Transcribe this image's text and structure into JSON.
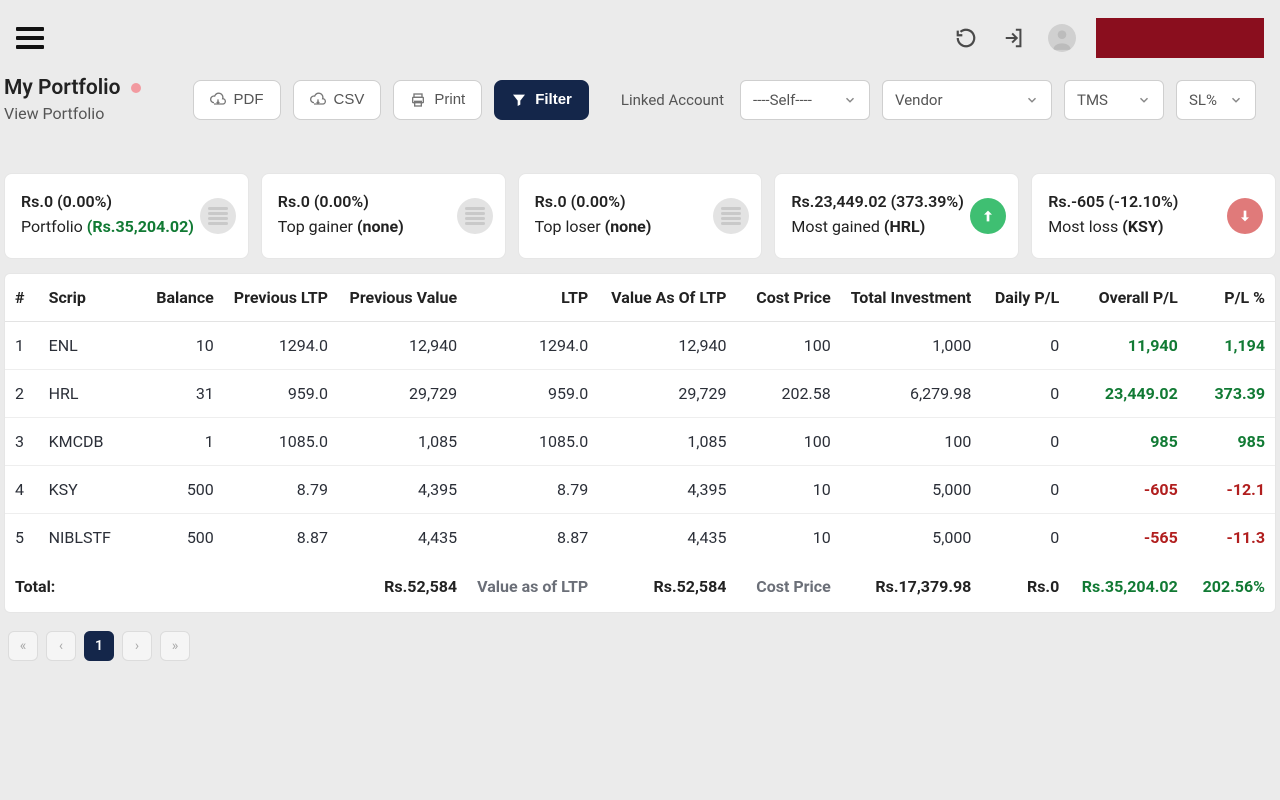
{
  "page": {
    "title": "My Portfolio",
    "subtitle": "View Portfolio"
  },
  "actions": {
    "pdf": "PDF",
    "csv": "CSV",
    "print": "Print",
    "filter": "Filter"
  },
  "linked_account": {
    "label": "Linked Account",
    "self_value": "----Self----",
    "vendor_value": "Vendor",
    "tms_value": "TMS",
    "sl_value": "SL%"
  },
  "cards": {
    "portfolio": {
      "amount": "Rs.0",
      "pct": "(0.00%)",
      "label": "Portfolio",
      "value": "(Rs.35,204.02)"
    },
    "top_gainer": {
      "amount": "Rs.0",
      "pct": "(0.00%)",
      "label": "Top gainer",
      "value": "(none)"
    },
    "top_loser": {
      "amount": "Rs.0",
      "pct": "(0.00%)",
      "label": "Top loser",
      "value": "(none)"
    },
    "most_gained": {
      "amount": "Rs.23,449.02",
      "pct": "(373.39%)",
      "label": "Most gained",
      "value": "(HRL)"
    },
    "most_loss": {
      "amount": "Rs.-605",
      "pct": "(-12.10%)",
      "label": "Most loss",
      "value": "(KSY)"
    }
  },
  "table": {
    "headers": {
      "idx": "#",
      "scrip": "Scrip",
      "balance": "Balance",
      "prev_ltp": "Previous LTP",
      "prev_value": "Previous Value",
      "ltp": "LTP",
      "value_ltp": "Value As Of LTP",
      "cost_price": "Cost Price",
      "total_inv": "Total Investment",
      "daily_pl": "Daily P/L",
      "overall_pl": "Overall P/L",
      "pl_pct": "P/L %"
    },
    "rows": [
      {
        "idx": "1",
        "scrip": "ENL",
        "balance": "10",
        "prev_ltp": "1294.0",
        "prev_value": "12,940",
        "ltp": "1294.0",
        "value_ltp": "12,940",
        "cost_price": "100",
        "total_inv": "1,000",
        "daily_pl": "0",
        "overall_pl": "11,940",
        "pl_pct": "1,194",
        "pl_dir": "up"
      },
      {
        "idx": "2",
        "scrip": "HRL",
        "balance": "31",
        "prev_ltp": "959.0",
        "prev_value": "29,729",
        "ltp": "959.0",
        "value_ltp": "29,729",
        "cost_price": "202.58",
        "total_inv": "6,279.98",
        "daily_pl": "0",
        "overall_pl": "23,449.02",
        "pl_pct": "373.39",
        "pl_dir": "up"
      },
      {
        "idx": "3",
        "scrip": "KMCDB",
        "balance": "1",
        "prev_ltp": "1085.0",
        "prev_value": "1,085",
        "ltp": "1085.0",
        "value_ltp": "1,085",
        "cost_price": "100",
        "total_inv": "100",
        "daily_pl": "0",
        "overall_pl": "985",
        "pl_pct": "985",
        "pl_dir": "up"
      },
      {
        "idx": "4",
        "scrip": "KSY",
        "balance": "500",
        "prev_ltp": "8.79",
        "prev_value": "4,395",
        "ltp": "8.79",
        "value_ltp": "4,395",
        "cost_price": "10",
        "total_inv": "5,000",
        "daily_pl": "0",
        "overall_pl": "-605",
        "pl_pct": "-12.1",
        "pl_dir": "down"
      },
      {
        "idx": "5",
        "scrip": "NIBLSTF",
        "balance": "500",
        "prev_ltp": "8.87",
        "prev_value": "4,435",
        "ltp": "8.87",
        "value_ltp": "4,435",
        "cost_price": "10",
        "total_inv": "5,000",
        "daily_pl": "0",
        "overall_pl": "-565",
        "pl_pct": "-11.3",
        "pl_dir": "down"
      }
    ],
    "footer": {
      "total_label": "Total:",
      "prev_value": "Rs.52,584",
      "value_ltp_label": "Value as of LTP",
      "value_ltp": "Rs.52,584",
      "cost_price_label": "Cost Price",
      "total_inv": "Rs.17,379.98",
      "daily_pl": "Rs.0",
      "overall_pl": "Rs.35,204.02",
      "pl_pct": "202.56%"
    }
  },
  "pager": {
    "first": "«",
    "prev": "‹",
    "current": "1",
    "next": "›",
    "last": "»"
  }
}
